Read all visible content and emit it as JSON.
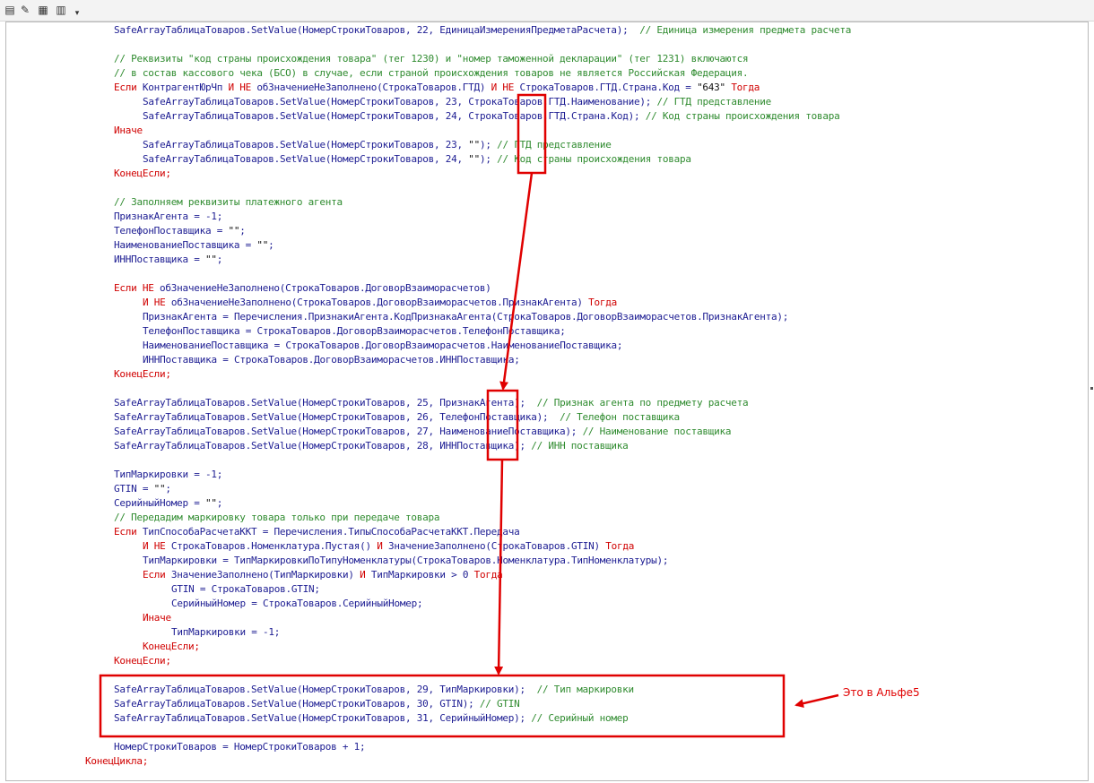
{
  "toolbar": {
    "buttons": [
      {
        "name": "module-icon",
        "glyph": "▤"
      },
      {
        "name": "syntax-check-icon",
        "glyph": "✎"
      },
      {
        "name": "settings-icon",
        "glyph": "▦"
      },
      {
        "name": "document-icon",
        "glyph": "▥"
      },
      {
        "name": "dropdown-arrow-icon",
        "glyph": "▾"
      }
    ]
  },
  "code_lines": [
    {
      "indent": 1,
      "parts": [
        [
          "t",
          "SafeArrayТаблицаТоваров.SetValue(НомерСтрокиТоваров, 22, ЕдиницаИзмеренияПредметаРасчета);  "
        ],
        [
          "c",
          "// Единица измерения предмета расчета"
        ]
      ]
    },
    {
      "indent": 0,
      "parts": []
    },
    {
      "indent": 1,
      "parts": [
        [
          "c",
          "// Реквизиты \"код страны происхождения товара\" (тег 1230) и \"номер таможенной декларации\" (тег 1231) включаются"
        ]
      ]
    },
    {
      "indent": 1,
      "parts": [
        [
          "c",
          "// в состав кассового чека (БСО) в случае, если страной происхождения товаров не является Российская Федерация."
        ]
      ]
    },
    {
      "indent": 1,
      "parts": [
        [
          "k",
          "Если "
        ],
        [
          "t",
          "КонтрагентЮрЧп "
        ],
        [
          "k",
          "И НЕ "
        ],
        [
          "t",
          "обЗначениеНеЗаполнено(СтрокаТоваров.ГТД) "
        ],
        [
          "k",
          "И НЕ "
        ],
        [
          "t",
          "СтрокаТоваров.ГТД.Страна.Код = "
        ],
        [
          "s",
          "\"643\" "
        ],
        [
          "k",
          "Тогда"
        ]
      ]
    },
    {
      "indent": 2,
      "parts": [
        [
          "t",
          "SafeArrayТаблицаТоваров.SetValue(НомерСтрокиТоваров, 23, СтрокаТоваров.ГТД.Наименование); "
        ],
        [
          "c",
          "// ГТД представление"
        ]
      ]
    },
    {
      "indent": 2,
      "parts": [
        [
          "t",
          "SafeArrayТаблицаТоваров.SetValue(НомерСтрокиТоваров, 24, СтрокаТоваров.ГТД.Страна.Код); "
        ],
        [
          "c",
          "// Код страны происхождения товара"
        ]
      ]
    },
    {
      "indent": 1,
      "parts": [
        [
          "k",
          "Иначе"
        ]
      ]
    },
    {
      "indent": 2,
      "parts": [
        [
          "t",
          "SafeArrayТаблицаТоваров.SetValue(НомерСтрокиТоваров, 23, "
        ],
        [
          "s",
          "\"\""
        ],
        [
          "t",
          "); "
        ],
        [
          "c",
          "// ГТД представление"
        ]
      ]
    },
    {
      "indent": 2,
      "parts": [
        [
          "t",
          "SafeArrayТаблицаТоваров.SetValue(НомерСтрокиТоваров, 24, "
        ],
        [
          "s",
          "\"\""
        ],
        [
          "t",
          "); "
        ],
        [
          "c",
          "// Код страны происхождения товара"
        ]
      ]
    },
    {
      "indent": 1,
      "parts": [
        [
          "k",
          "КонецЕсли;"
        ]
      ]
    },
    {
      "indent": 0,
      "parts": []
    },
    {
      "indent": 1,
      "parts": [
        [
          "c",
          "// Заполняем реквизиты платежного агента"
        ]
      ]
    },
    {
      "indent": 1,
      "parts": [
        [
          "t",
          "ПризнакАгента = -1;"
        ]
      ]
    },
    {
      "indent": 1,
      "parts": [
        [
          "t",
          "ТелефонПоставщика = "
        ],
        [
          "s",
          "\"\""
        ],
        [
          "t",
          ";"
        ]
      ]
    },
    {
      "indent": 1,
      "parts": [
        [
          "t",
          "НаименованиеПоставщика = "
        ],
        [
          "s",
          "\"\""
        ],
        [
          "t",
          ";"
        ]
      ]
    },
    {
      "indent": 1,
      "parts": [
        [
          "t",
          "ИННПоставщика = "
        ],
        [
          "s",
          "\"\""
        ],
        [
          "t",
          ";"
        ]
      ]
    },
    {
      "indent": 0,
      "parts": []
    },
    {
      "indent": 1,
      "parts": [
        [
          "k",
          "Если НЕ "
        ],
        [
          "t",
          "обЗначениеНеЗаполнено(СтрокаТоваров.ДоговорВзаиморасчетов)"
        ]
      ]
    },
    {
      "indent": 2,
      "parts": [
        [
          "k",
          "И НЕ "
        ],
        [
          "t",
          "обЗначениеНеЗаполнено(СтрокаТоваров.ДоговорВзаиморасчетов.ПризнакАгента) "
        ],
        [
          "k",
          "Тогда"
        ]
      ]
    },
    {
      "indent": 2,
      "parts": [
        [
          "t",
          "ПризнакАгента = Перечисления.ПризнакиАгента.КодПризнакаАгента(СтрокаТоваров.ДоговорВзаиморасчетов.ПризнакАгента);"
        ]
      ]
    },
    {
      "indent": 2,
      "parts": [
        [
          "t",
          "ТелефонПоставщика = СтрокаТоваров.ДоговорВзаиморасчетов.ТелефонПоставщика;"
        ]
      ]
    },
    {
      "indent": 2,
      "parts": [
        [
          "t",
          "НаименованиеПоставщика = СтрокаТоваров.ДоговорВзаиморасчетов.НаименованиеПоставщика;"
        ]
      ]
    },
    {
      "indent": 2,
      "parts": [
        [
          "t",
          "ИННПоставщика = СтрокаТоваров.ДоговорВзаиморасчетов.ИННПоставщика;"
        ]
      ]
    },
    {
      "indent": 1,
      "parts": [
        [
          "k",
          "КонецЕсли;"
        ]
      ]
    },
    {
      "indent": 0,
      "parts": []
    },
    {
      "indent": 1,
      "parts": [
        [
          "t",
          "SafeArrayТаблицаТоваров.SetValue(НомерСтрокиТоваров, 25, ПризнакАгента);  "
        ],
        [
          "c",
          "// Признак агента по предмету расчета"
        ]
      ]
    },
    {
      "indent": 1,
      "parts": [
        [
          "t",
          "SafeArrayТаблицаТоваров.SetValue(НомерСтрокиТоваров, 26, ТелефонПоставщика);  "
        ],
        [
          "c",
          "// Телефон поставщика"
        ]
      ]
    },
    {
      "indent": 1,
      "parts": [
        [
          "t",
          "SafeArrayТаблицаТоваров.SetValue(НомерСтрокиТоваров, 27, НаименованиеПоставщика); "
        ],
        [
          "c",
          "// Наименование поставщика"
        ]
      ]
    },
    {
      "indent": 1,
      "parts": [
        [
          "t",
          "SafeArrayТаблицаТоваров.SetValue(НомерСтрокиТоваров, 28, ИННПоставщика); "
        ],
        [
          "c",
          "// ИНН поставщика"
        ]
      ]
    },
    {
      "indent": 0,
      "parts": []
    },
    {
      "indent": 1,
      "parts": [
        [
          "t",
          "ТипМаркировки = -1;"
        ]
      ]
    },
    {
      "indent": 1,
      "parts": [
        [
          "t",
          "GTIN = "
        ],
        [
          "s",
          "\"\""
        ],
        [
          "t",
          ";"
        ]
      ]
    },
    {
      "indent": 1,
      "parts": [
        [
          "t",
          "СерийныйНомер = "
        ],
        [
          "s",
          "\"\""
        ],
        [
          "t",
          ";"
        ]
      ]
    },
    {
      "indent": 1,
      "parts": [
        [
          "c",
          "// Передадим маркировку товара только при передаче товара"
        ]
      ]
    },
    {
      "indent": 1,
      "parts": [
        [
          "k",
          "Если "
        ],
        [
          "t",
          "ТипСпособаРасчетаККТ = Перечисления.ТипыСпособаРасчетаККТ.Передача"
        ]
      ]
    },
    {
      "indent": 2,
      "parts": [
        [
          "k",
          "И НЕ "
        ],
        [
          "t",
          "СтрокаТоваров.Номенклатура.Пустая() "
        ],
        [
          "k",
          "И "
        ],
        [
          "t",
          "ЗначениеЗаполнено(СтрокаТоваров.GTIN) "
        ],
        [
          "k",
          "Тогда"
        ]
      ]
    },
    {
      "indent": 2,
      "parts": [
        [
          "t",
          "ТипМаркировки = ТипМаркировкиПоТипуНоменклатуры(СтрокаТоваров.Номенклатура.ТипНоменклатуры);"
        ]
      ]
    },
    {
      "indent": 2,
      "parts": [
        [
          "k",
          "Если "
        ],
        [
          "t",
          "ЗначениеЗаполнено(ТипМаркировки) "
        ],
        [
          "k",
          "И "
        ],
        [
          "t",
          "ТипМаркировки > 0 "
        ],
        [
          "k",
          "Тогда"
        ]
      ]
    },
    {
      "indent": 3,
      "parts": [
        [
          "t",
          "GTIN = СтрокаТоваров.GTIN;"
        ]
      ]
    },
    {
      "indent": 3,
      "parts": [
        [
          "t",
          "СерийныйНомер = СтрокаТоваров.СерийныйНомер;"
        ]
      ]
    },
    {
      "indent": 2,
      "parts": [
        [
          "k",
          "Иначе"
        ]
      ]
    },
    {
      "indent": 3,
      "parts": [
        [
          "t",
          "ТипМаркировки = -1;"
        ]
      ]
    },
    {
      "indent": 2,
      "parts": [
        [
          "k",
          "КонецЕсли;"
        ]
      ]
    },
    {
      "indent": 1,
      "parts": [
        [
          "k",
          "КонецЕсли;"
        ]
      ]
    },
    {
      "indent": 0,
      "parts": []
    },
    {
      "indent": 1,
      "parts": [
        [
          "t",
          "SafeArrayТаблицаТоваров.SetValue(НомерСтрокиТоваров, 29, ТипМаркировки);  "
        ],
        [
          "c",
          "// Тип маркировки"
        ]
      ]
    },
    {
      "indent": 1,
      "parts": [
        [
          "t",
          "SafeArrayТаблицаТоваров.SetValue(НомерСтрокиТоваров, 30, GTIN); "
        ],
        [
          "c",
          "// GTIN"
        ]
      ]
    },
    {
      "indent": 1,
      "parts": [
        [
          "t",
          "SafeArrayТаблицаТоваров.SetValue(НомерСтрокиТоваров, 31, СерийныйНомер); "
        ],
        [
          "c",
          "// Серийный номер"
        ]
      ]
    },
    {
      "indent": 0,
      "parts": []
    },
    {
      "indent": 1,
      "parts": [
        [
          "t",
          "НомерСтрокиТоваров = НомерСтрокиТоваров + 1;"
        ]
      ]
    },
    {
      "indent": 0,
      "parts": [
        [
          "k",
          "КонецЦикла;"
        ]
      ]
    }
  ],
  "annotation": {
    "text": "Это в Альфе5",
    "color": "#e00000"
  }
}
